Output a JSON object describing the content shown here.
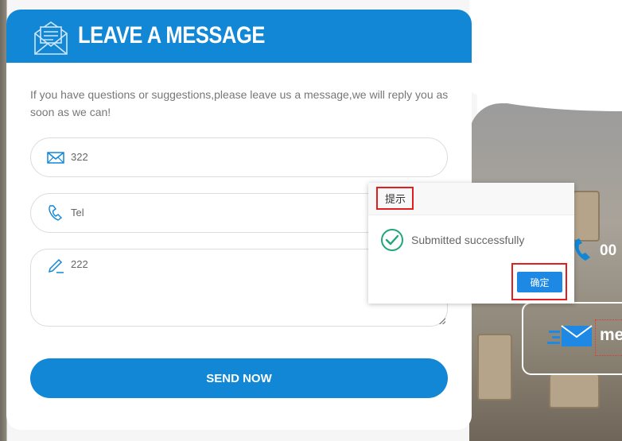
{
  "form": {
    "title": "LEAVE A MESSAGE",
    "intro": "If you have questions or suggestions,please leave us a message,we will reply you as soon as we can!",
    "fields": [
      {
        "icon": "mail-icon",
        "value": "322"
      },
      {
        "icon": "phone-icon",
        "value": "Tel"
      },
      {
        "icon": "pencil-icon",
        "value": "222"
      }
    ],
    "submit_label": "SEND NOW"
  },
  "dialog": {
    "title": "提示",
    "message": "Submitted successfully",
    "confirm_label": "确定",
    "status_icon": "check-circle-icon"
  },
  "contact": {
    "phone_fragment": "00",
    "mail_fragment": "me"
  },
  "colors": {
    "brand_blue": "#1187d6",
    "success_green": "#1fa67a",
    "highlight_red": "#e02020"
  }
}
